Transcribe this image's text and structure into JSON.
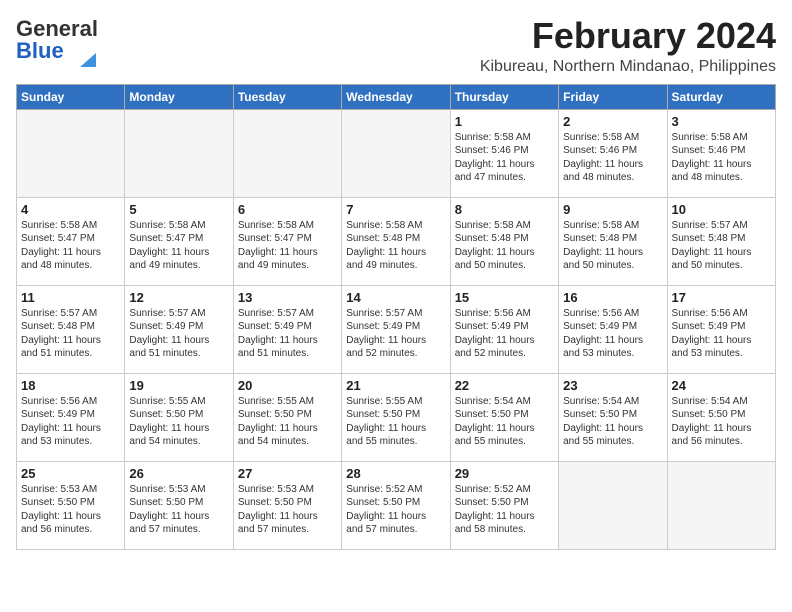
{
  "header": {
    "logo_general": "General",
    "logo_blue": "Blue",
    "month_title": "February 2024",
    "location": "Kibureau, Northern Mindanao, Philippines"
  },
  "weekdays": [
    "Sunday",
    "Monday",
    "Tuesday",
    "Wednesday",
    "Thursday",
    "Friday",
    "Saturday"
  ],
  "weeks": [
    [
      {
        "day": "",
        "info": ""
      },
      {
        "day": "",
        "info": ""
      },
      {
        "day": "",
        "info": ""
      },
      {
        "day": "",
        "info": ""
      },
      {
        "day": "1",
        "info": "Sunrise: 5:58 AM\nSunset: 5:46 PM\nDaylight: 11 hours\nand 47 minutes."
      },
      {
        "day": "2",
        "info": "Sunrise: 5:58 AM\nSunset: 5:46 PM\nDaylight: 11 hours\nand 48 minutes."
      },
      {
        "day": "3",
        "info": "Sunrise: 5:58 AM\nSunset: 5:46 PM\nDaylight: 11 hours\nand 48 minutes."
      }
    ],
    [
      {
        "day": "4",
        "info": "Sunrise: 5:58 AM\nSunset: 5:47 PM\nDaylight: 11 hours\nand 48 minutes."
      },
      {
        "day": "5",
        "info": "Sunrise: 5:58 AM\nSunset: 5:47 PM\nDaylight: 11 hours\nand 49 minutes."
      },
      {
        "day": "6",
        "info": "Sunrise: 5:58 AM\nSunset: 5:47 PM\nDaylight: 11 hours\nand 49 minutes."
      },
      {
        "day": "7",
        "info": "Sunrise: 5:58 AM\nSunset: 5:48 PM\nDaylight: 11 hours\nand 49 minutes."
      },
      {
        "day": "8",
        "info": "Sunrise: 5:58 AM\nSunset: 5:48 PM\nDaylight: 11 hours\nand 50 minutes."
      },
      {
        "day": "9",
        "info": "Sunrise: 5:58 AM\nSunset: 5:48 PM\nDaylight: 11 hours\nand 50 minutes."
      },
      {
        "day": "10",
        "info": "Sunrise: 5:57 AM\nSunset: 5:48 PM\nDaylight: 11 hours\nand 50 minutes."
      }
    ],
    [
      {
        "day": "11",
        "info": "Sunrise: 5:57 AM\nSunset: 5:48 PM\nDaylight: 11 hours\nand 51 minutes."
      },
      {
        "day": "12",
        "info": "Sunrise: 5:57 AM\nSunset: 5:49 PM\nDaylight: 11 hours\nand 51 minutes."
      },
      {
        "day": "13",
        "info": "Sunrise: 5:57 AM\nSunset: 5:49 PM\nDaylight: 11 hours\nand 51 minutes."
      },
      {
        "day": "14",
        "info": "Sunrise: 5:57 AM\nSunset: 5:49 PM\nDaylight: 11 hours\nand 52 minutes."
      },
      {
        "day": "15",
        "info": "Sunrise: 5:56 AM\nSunset: 5:49 PM\nDaylight: 11 hours\nand 52 minutes."
      },
      {
        "day": "16",
        "info": "Sunrise: 5:56 AM\nSunset: 5:49 PM\nDaylight: 11 hours\nand 53 minutes."
      },
      {
        "day": "17",
        "info": "Sunrise: 5:56 AM\nSunset: 5:49 PM\nDaylight: 11 hours\nand 53 minutes."
      }
    ],
    [
      {
        "day": "18",
        "info": "Sunrise: 5:56 AM\nSunset: 5:49 PM\nDaylight: 11 hours\nand 53 minutes."
      },
      {
        "day": "19",
        "info": "Sunrise: 5:55 AM\nSunset: 5:50 PM\nDaylight: 11 hours\nand 54 minutes."
      },
      {
        "day": "20",
        "info": "Sunrise: 5:55 AM\nSunset: 5:50 PM\nDaylight: 11 hours\nand 54 minutes."
      },
      {
        "day": "21",
        "info": "Sunrise: 5:55 AM\nSunset: 5:50 PM\nDaylight: 11 hours\nand 55 minutes."
      },
      {
        "day": "22",
        "info": "Sunrise: 5:54 AM\nSunset: 5:50 PM\nDaylight: 11 hours\nand 55 minutes."
      },
      {
        "day": "23",
        "info": "Sunrise: 5:54 AM\nSunset: 5:50 PM\nDaylight: 11 hours\nand 55 minutes."
      },
      {
        "day": "24",
        "info": "Sunrise: 5:54 AM\nSunset: 5:50 PM\nDaylight: 11 hours\nand 56 minutes."
      }
    ],
    [
      {
        "day": "25",
        "info": "Sunrise: 5:53 AM\nSunset: 5:50 PM\nDaylight: 11 hours\nand 56 minutes."
      },
      {
        "day": "26",
        "info": "Sunrise: 5:53 AM\nSunset: 5:50 PM\nDaylight: 11 hours\nand 57 minutes."
      },
      {
        "day": "27",
        "info": "Sunrise: 5:53 AM\nSunset: 5:50 PM\nDaylight: 11 hours\nand 57 minutes."
      },
      {
        "day": "28",
        "info": "Sunrise: 5:52 AM\nSunset: 5:50 PM\nDaylight: 11 hours\nand 57 minutes."
      },
      {
        "day": "29",
        "info": "Sunrise: 5:52 AM\nSunset: 5:50 PM\nDaylight: 11 hours\nand 58 minutes."
      },
      {
        "day": "",
        "info": ""
      },
      {
        "day": "",
        "info": ""
      }
    ]
  ]
}
